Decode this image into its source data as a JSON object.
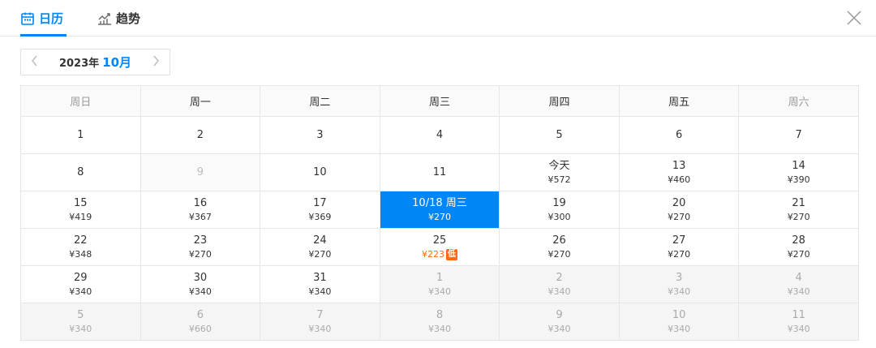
{
  "tabs": {
    "calendar_label": "日历",
    "trend_label": "趋势"
  },
  "month_nav": {
    "year": "2023年",
    "month": "10月"
  },
  "weekdays": [
    "周日",
    "周一",
    "周二",
    "周三",
    "周四",
    "周五",
    "周六"
  ],
  "weeks": [
    [
      {
        "day": "1",
        "price": ""
      },
      {
        "day": "2",
        "price": ""
      },
      {
        "day": "3",
        "price": ""
      },
      {
        "day": "4",
        "price": ""
      },
      {
        "day": "5",
        "price": ""
      },
      {
        "day": "6",
        "price": ""
      },
      {
        "day": "7",
        "price": ""
      }
    ],
    [
      {
        "day": "8",
        "price": ""
      },
      {
        "day": "9",
        "price": "",
        "state": "na"
      },
      {
        "day": "10",
        "price": ""
      },
      {
        "day": "11",
        "price": ""
      },
      {
        "day": "今天",
        "price": "¥572"
      },
      {
        "day": "13",
        "price": "¥460"
      },
      {
        "day": "14",
        "price": "¥390"
      }
    ],
    [
      {
        "day": "15",
        "price": "¥419"
      },
      {
        "day": "16",
        "price": "¥367"
      },
      {
        "day": "17",
        "price": "¥369"
      },
      {
        "day": "10/18 周三",
        "price": "¥270",
        "state": "selected"
      },
      {
        "day": "19",
        "price": "¥300"
      },
      {
        "day": "20",
        "price": "¥270"
      },
      {
        "day": "21",
        "price": "¥270"
      }
    ],
    [
      {
        "day": "22",
        "price": "¥348"
      },
      {
        "day": "23",
        "price": "¥270"
      },
      {
        "day": "24",
        "price": "¥270"
      },
      {
        "day": "25",
        "price": "¥223",
        "state": "lowest",
        "badge": "低"
      },
      {
        "day": "26",
        "price": "¥270"
      },
      {
        "day": "27",
        "price": "¥270"
      },
      {
        "day": "28",
        "price": "¥270"
      }
    ],
    [
      {
        "day": "29",
        "price": "¥340"
      },
      {
        "day": "30",
        "price": "¥340"
      },
      {
        "day": "31",
        "price": "¥340"
      },
      {
        "day": "1",
        "price": "¥340",
        "state": "other"
      },
      {
        "day": "2",
        "price": "¥340",
        "state": "other"
      },
      {
        "day": "3",
        "price": "¥340",
        "state": "other"
      },
      {
        "day": "4",
        "price": "¥340",
        "state": "other"
      }
    ],
    [
      {
        "day": "5",
        "price": "¥340",
        "state": "other"
      },
      {
        "day": "6",
        "price": "¥660",
        "state": "other"
      },
      {
        "day": "7",
        "price": "¥340",
        "state": "other"
      },
      {
        "day": "8",
        "price": "¥340",
        "state": "other"
      },
      {
        "day": "9",
        "price": "¥340",
        "state": "other"
      },
      {
        "day": "10",
        "price": "¥340",
        "state": "other"
      },
      {
        "day": "11",
        "price": "¥340",
        "state": "other"
      }
    ]
  ],
  "colors": {
    "accent": "#0086f6",
    "lowest": "#ff6913"
  },
  "icons": {
    "calendar_tab": "calendar-icon",
    "trend_tab": "trend-chart-icon",
    "close": "close-icon",
    "prev": "chevron-left-icon",
    "next": "chevron-right-icon"
  }
}
